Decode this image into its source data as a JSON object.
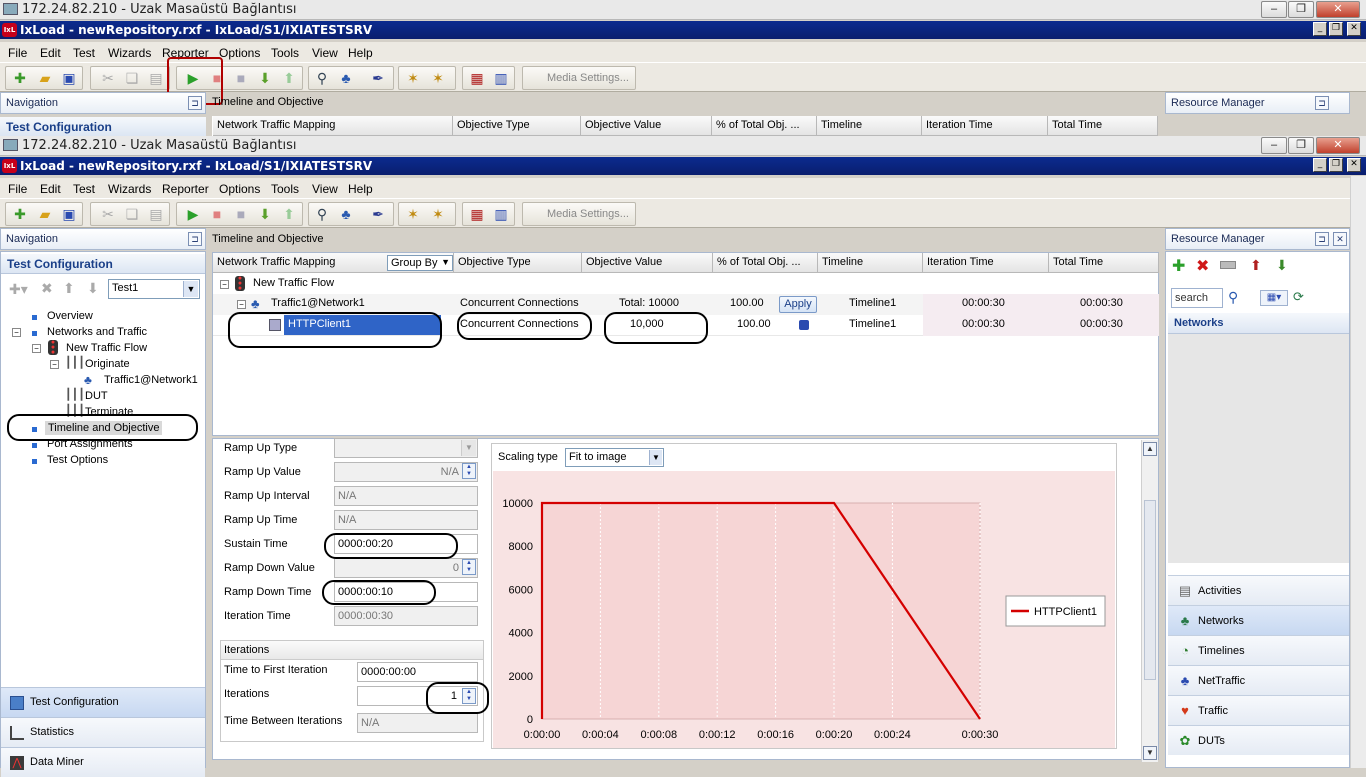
{
  "rdp": {
    "title": "172.24.82.210 - Uzak Masaüstü Bağlantısı"
  },
  "app": {
    "title": "IxLoad - newRepository.rxf - IxLoad/S1/IXIATESTSRV",
    "icon_text": "IxL"
  },
  "menu": [
    "File",
    "Edit",
    "Test",
    "Wizards",
    "Reporter",
    "Options",
    "Tools",
    "View",
    "Help"
  ],
  "toolbar": {
    "media_settings": "Media Settings..."
  },
  "navigation": {
    "title": "Navigation",
    "section": "Test Configuration",
    "test_select": "Test1",
    "tree": [
      "Overview",
      "Networks and Traffic",
      "New Traffic Flow",
      "Originate",
      "Traffic1@Network1",
      "DUT",
      "Terminate",
      "Timeline and Objective",
      "Port Assignments",
      "Test Options"
    ],
    "bottom": [
      "Test Configuration",
      "Statistics",
      "Data Miner"
    ]
  },
  "center": {
    "title": "Timeline and Objective",
    "group_by": "Group By",
    "columns": [
      "Network Traffic Mapping",
      "Objective Type",
      "Objective Value",
      "% of Total Obj. ...",
      "Timeline",
      "Iteration Time",
      "Total Time"
    ],
    "flow": "New Traffic Flow",
    "rows": [
      {
        "name": "Traffic1@Network1",
        "type": "Concurrent Connections",
        "value": "Total: 10000",
        "pct": "100.00",
        "apply": "Apply",
        "timeline": "Timeline1",
        "iter": "00:00:30",
        "total": "00:00:30"
      },
      {
        "name": "HTTPClient1",
        "type": "Concurrent Connections",
        "value": "10,000",
        "pct": "100.00",
        "timeline": "Timeline1",
        "iter": "00:00:30",
        "total": "00:00:30"
      }
    ]
  },
  "timeline": {
    "fields": [
      {
        "label": "Ramp Up Type",
        "value": ""
      },
      {
        "label": "Ramp Up Value",
        "value": "N/A"
      },
      {
        "label": "Ramp Up Interval",
        "value": "N/A"
      },
      {
        "label": "Ramp Up Time",
        "value": "N/A"
      },
      {
        "label": "Sustain Time",
        "value": "0000:00:20"
      },
      {
        "label": "Ramp Down Value",
        "value": "0"
      },
      {
        "label": "Ramp Down Time",
        "value": "0000:00:10"
      },
      {
        "label": "Iteration Time",
        "value": "0000:00:30"
      }
    ],
    "iterations_title": "Iterations",
    "iter_fields": [
      {
        "label": "Time to First Iteration",
        "value": "0000:00:00"
      },
      {
        "label": "Iterations",
        "value": "1"
      },
      {
        "label": "Time Between Iterations",
        "value": "N/A"
      }
    ],
    "scaling_label": "Scaling type",
    "scaling_value": "Fit to image"
  },
  "chart_data": {
    "type": "line",
    "series": [
      {
        "name": "HTTPClient1",
        "x": [
          0,
          0,
          20,
          30
        ],
        "y": [
          0,
          10000,
          10000,
          0
        ],
        "color": "#d40000"
      }
    ],
    "xticks": [
      "0:00:00",
      "0:00:04",
      "0:00:08",
      "0:00:12",
      "0:00:16",
      "0:00:20",
      "0:00:24",
      "0:00:30"
    ],
    "xtick_values": [
      0,
      4,
      8,
      12,
      16,
      20,
      24,
      30
    ],
    "yticks": [
      "0",
      "2000",
      "4000",
      "6000",
      "8000",
      "10000"
    ],
    "ytick_values": [
      0,
      2000,
      4000,
      6000,
      8000,
      10000
    ],
    "xlim": [
      0,
      30
    ],
    "ylim": [
      0,
      10000
    ],
    "legend_placement": "right",
    "grid": true
  },
  "resource": {
    "title": "Resource Manager",
    "search_placeholder": "search",
    "networks": "Networks",
    "buttons": [
      "Activities",
      "Networks",
      "Timelines",
      "NetTraffic",
      "Traffic",
      "DUTs"
    ]
  }
}
